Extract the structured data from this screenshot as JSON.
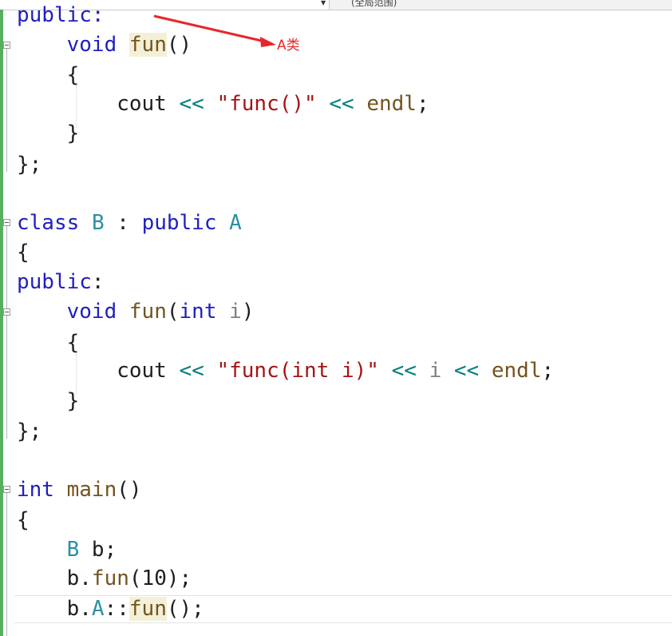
{
  "toolbar": {
    "scope_label": "(全局范围)"
  },
  "annotation": {
    "label": "A类",
    "color": "#e8262a"
  },
  "code": {
    "l01": [
      "public:"
    ],
    "l02": [
      "    ",
      "void",
      " ",
      "fun",
      "()"
    ],
    "l03": [
      "    {"
    ],
    "l04": [
      "        cout ",
      "<<",
      " ",
      "\"func()\"",
      " ",
      "<<",
      " ",
      "endl",
      ";"
    ],
    "l05": [
      "    }"
    ],
    "l06": [
      "};"
    ],
    "l08": [
      "class",
      " ",
      "B",
      " : ",
      "public",
      " ",
      "A"
    ],
    "l09": [
      "{"
    ],
    "l10": [
      "public",
      ":"
    ],
    "l11": [
      "    ",
      "void",
      " ",
      "fun",
      "(",
      "int",
      " ",
      "i",
      ")"
    ],
    "l12": [
      "    {"
    ],
    "l13": [
      "        cout ",
      "<<",
      " ",
      "\"func(int i)\"",
      " ",
      "<<",
      " ",
      "i",
      " ",
      "<<",
      " ",
      "endl",
      ";"
    ],
    "l14": [
      "    }"
    ],
    "l15": [
      "};"
    ],
    "l17": [
      "int",
      " ",
      "main",
      "()"
    ],
    "l18": [
      "{"
    ],
    "l19": [
      "    ",
      "B",
      " b;"
    ],
    "l20": [
      "    b.",
      "fun",
      "(10);"
    ],
    "l21": [
      "    b.",
      "A",
      "::",
      "fun",
      "();"
    ]
  },
  "colors": {
    "keyword": "#1f1fbf",
    "type": "#2b8fa3",
    "function": "#74531f",
    "string": "#a31515",
    "operator": "#007f7f",
    "parameter": "#808080",
    "change_bar": "#57b05f"
  }
}
